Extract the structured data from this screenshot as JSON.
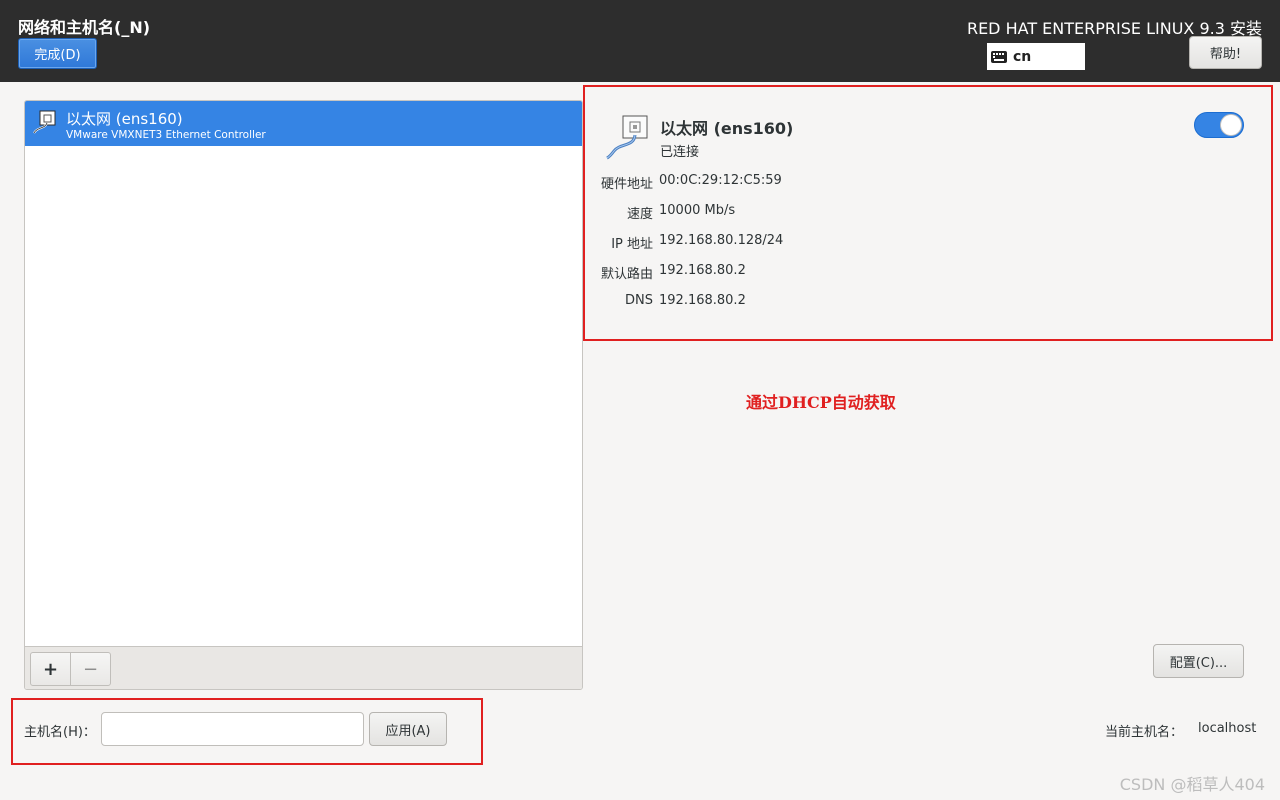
{
  "header": {
    "title": "网络和主机名(_N)",
    "done_label": "完成(D)",
    "product": "RED HAT ENTERPRISE LINUX 9.3 安装",
    "keyboard_layout": "cn",
    "help_label": "帮助!"
  },
  "device_list": {
    "items": [
      {
        "name": "以太网 (ens160)",
        "description": "VMware VMXNET3 Ethernet Controller",
        "selected": true
      }
    ],
    "add_label": "+",
    "remove_label": "−"
  },
  "details": {
    "name": "以太网 (ens160)",
    "status": "已连接",
    "enabled": true,
    "rows": [
      {
        "label": "硬件地址",
        "value": "00:0C:29:12:C5:59"
      },
      {
        "label": "速度",
        "value": "10000 Mb/s"
      },
      {
        "label": "IP 地址",
        "value": "192.168.80.128/24"
      },
      {
        "label": "默认路由",
        "value": "192.168.80.2"
      },
      {
        "label": "DNS",
        "value": "192.168.80.2"
      }
    ],
    "configure_label": "配置(C)..."
  },
  "annotation": "通过DHCP自动获取",
  "hostname": {
    "label": "主机名(H)：",
    "value": "",
    "placeholder": "",
    "apply_label": "应用(A)",
    "current_label": "当前主机名：",
    "current_value": "localhost"
  },
  "watermark": "CSDN @稻草人404",
  "colors": {
    "header_bg": "#2d2d2d",
    "accent": "#3584e4",
    "annotation_red": "#e02020",
    "background": "#f6f5f4"
  }
}
